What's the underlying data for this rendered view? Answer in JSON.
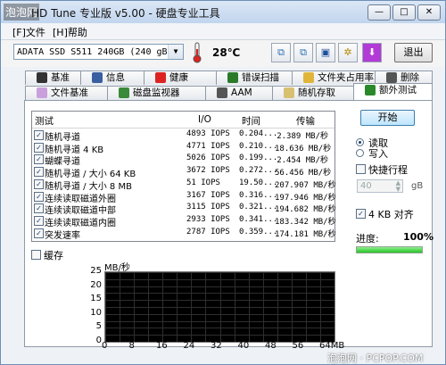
{
  "window": {
    "title": "HD Tune 专业版 v5.00 - 硬盘专业工具",
    "watermark": "泡泡网",
    "minimize": "—",
    "maximize": "□",
    "close": "✕"
  },
  "menu": [
    "[F]文件",
    "[H]帮助"
  ],
  "toolbar": {
    "drive": "ADATA SSD S511 240GB (240 gB)",
    "temperature": "28℃",
    "exit": "退出"
  },
  "tabs_row1": [
    "基准",
    "信息",
    "健康",
    "错误扫描",
    "文件夹占用率",
    "删除"
  ],
  "tabs_row2": [
    "文件基准",
    "磁盘监视器",
    "AAM",
    "随机存取",
    "额外测试"
  ],
  "table": {
    "headers": [
      "测试",
      "I/O",
      "时间",
      "传输"
    ],
    "rows": [
      {
        "name": "随机寻道",
        "io": "4893 IOPS",
        "time": "0.204...",
        "rate": "2.389 MB/秒"
      },
      {
        "name": "随机寻道 4 KB",
        "io": "4771 IOPS",
        "time": "0.210...",
        "rate": "18.636 MB/秒"
      },
      {
        "name": "蝴蝶寻道",
        "io": "5026 IOPS",
        "time": "0.199...",
        "rate": "2.454 MB/秒"
      },
      {
        "name": "随机寻道 / 大小 64 KB",
        "io": "3672 IOPS",
        "time": "0.272...",
        "rate": "56.456 MB/秒"
      },
      {
        "name": "随机寻道 / 大小 8 MB",
        "io": "51 IOPS",
        "time": "19.50...",
        "rate": "207.907 MB/秒"
      },
      {
        "name": "连续读取磁道外圈",
        "io": "3167 IOPS",
        "time": "0.316...",
        "rate": "197.946 MB/秒"
      },
      {
        "name": "连续读取磁道中部",
        "io": "3115 IOPS",
        "time": "0.321...",
        "rate": "194.682 MB/秒"
      },
      {
        "name": "连续读取磁道内圈",
        "io": "2933 IOPS",
        "time": "0.341...",
        "rate": "183.342 MB/秒"
      },
      {
        "name": "突发速率",
        "io": "2787 IOPS",
        "time": "0.359...",
        "rate": "174.181 MB/秒"
      }
    ]
  },
  "cache_label": "缓存",
  "chart": {
    "unit": "MB/秒",
    "y_ticks": [
      "25",
      "20",
      "15",
      "10",
      "5",
      "0"
    ],
    "x_ticks": [
      "0",
      "8",
      "16",
      "24",
      "32",
      "40",
      "48",
      "56",
      "64MB"
    ]
  },
  "side": {
    "start": "开始",
    "read": "读取",
    "write": "写入",
    "quick_stroke": "快捷行程",
    "stroke_value": "40",
    "stroke_unit": "gB",
    "align_4kb": "4 KB 对齐",
    "progress_label": "进度:",
    "progress_value": "100%",
    "progress_fraction": 1.0
  },
  "footer": "泡泡网 · PCPOP.COM",
  "colors": {
    "accent": "#3c7fb1",
    "progress": "#27c227",
    "chart_bg": "#000000"
  }
}
